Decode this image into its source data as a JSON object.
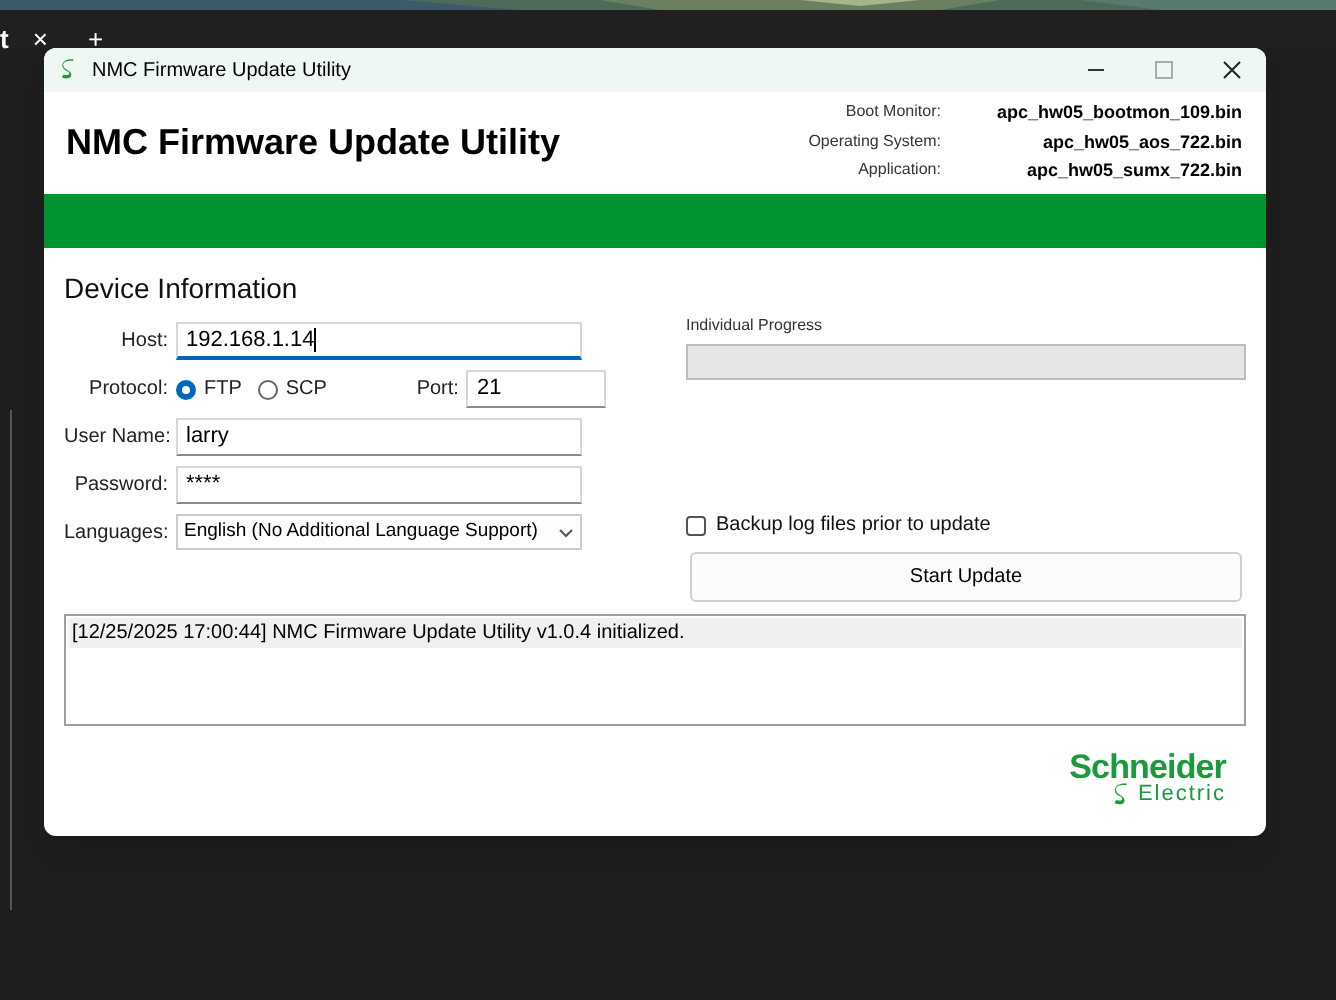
{
  "background": {
    "tab_label": "t",
    "tab_close": "×",
    "new_tab": "+"
  },
  "window": {
    "title": "NMC Firmware Update Utility"
  },
  "header": {
    "title": "NMC Firmware Update Utility",
    "files": [
      {
        "label": "Boot Monitor:",
        "value": "apc_hw05_bootmon_109.bin"
      },
      {
        "label": "Operating System:",
        "value": "apc_hw05_aos_722.bin"
      },
      {
        "label": "Application:",
        "value": "apc_hw05_sumx_722.bin"
      }
    ]
  },
  "device": {
    "heading": "Device Information",
    "host": {
      "label": "Host:",
      "value": "192.168.1.14",
      "focused": true
    },
    "protocol": {
      "label": "Protocol:",
      "options": [
        {
          "label": "FTP",
          "selected": true
        },
        {
          "label": "SCP",
          "selected": false
        }
      ]
    },
    "port": {
      "label": "Port:",
      "value": "21"
    },
    "user": {
      "label": "User Name:",
      "value": "larry"
    },
    "password": {
      "label": "Password:",
      "value": "****"
    },
    "language": {
      "label": "Languages:",
      "value": "English (No Additional Language Support)"
    }
  },
  "progress": {
    "label": "Individual Progress",
    "level": 0
  },
  "backup": {
    "label": "Backup log files prior to update",
    "checked": false
  },
  "start_button": "Start Update",
  "log": [
    {
      "text": "[12/25/2025 17:00:44] NMC Firmware Update Utility v1.0.4 initialized.",
      "selected": true
    }
  ],
  "logo": {
    "name": "Schneider",
    "sub": "Electric"
  }
}
